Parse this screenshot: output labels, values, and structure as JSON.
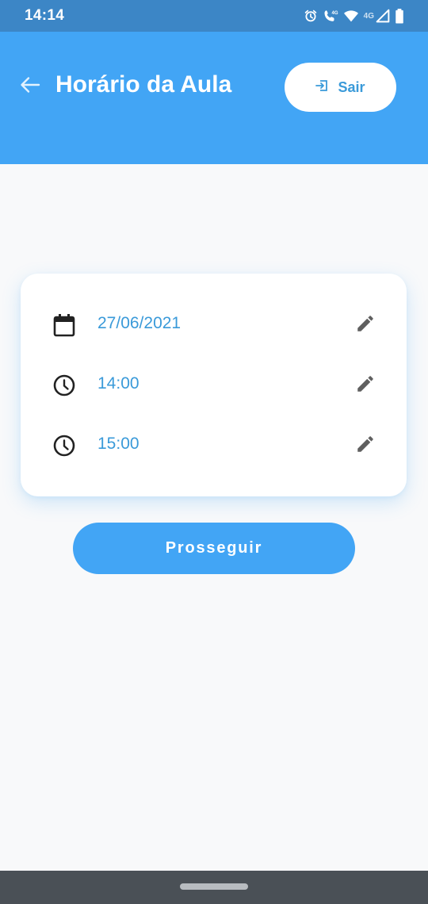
{
  "status_bar": {
    "time": "14:14",
    "network_label": "4G"
  },
  "header": {
    "title": "Horário da Aula",
    "logout_label": "Sair"
  },
  "schedule": {
    "rows": [
      {
        "icon": "calendar-icon",
        "value": "27/06/2021"
      },
      {
        "icon": "clock-icon",
        "value": "14:00"
      },
      {
        "icon": "clock-icon",
        "value": "15:00"
      }
    ]
  },
  "actions": {
    "continue_label": "Prosseguir"
  },
  "colors": {
    "status_bar": "#3c86c6",
    "app_bar": "#42a5f5",
    "accent_text": "#3a9ad9",
    "background": "#f8f9fa",
    "nav_bar": "#4a5056"
  }
}
